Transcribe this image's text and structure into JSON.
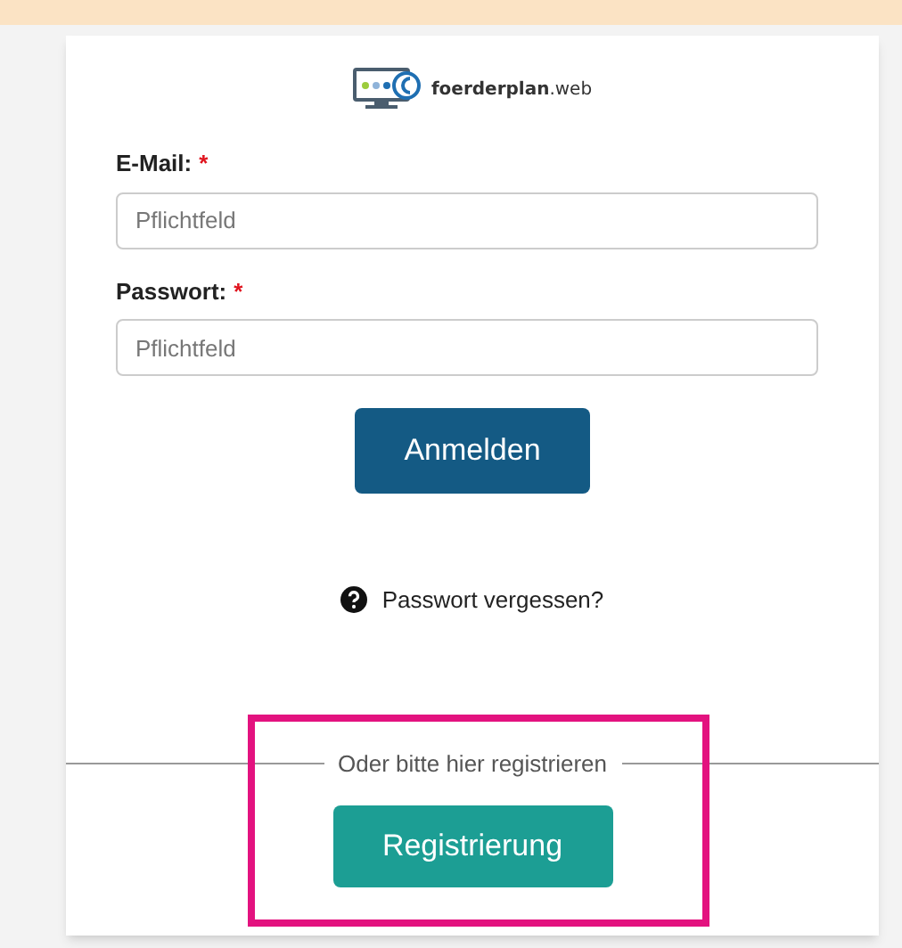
{
  "logo": {
    "text": "**foerderplan**.web"
  },
  "fields": [
    {
      "label": "E-Mail:",
      "required_mark": "*",
      "placeholder": "Pflichtfeld"
    },
    {
      "label": "Passwort:",
      "required_mark": "*",
      "placeholder": "Pflichtfeld"
    }
  ],
  "login_button": "Anmelden",
  "forgot_link": "Passwort vergessen?",
  "register": {
    "legend": "Oder bitte hier registrieren",
    "button": "Registrierung",
    "highlighted": true
  }
}
